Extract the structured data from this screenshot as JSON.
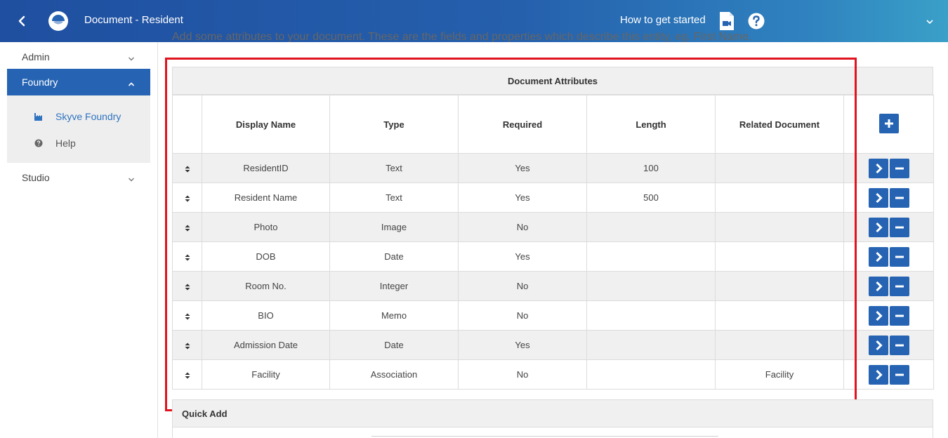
{
  "header": {
    "title": "Document - Resident",
    "how_to_label": "How to get started"
  },
  "sidebar": {
    "admin_label": "Admin",
    "foundry_label": "Foundry",
    "foundry_items": [
      {
        "label": "Skyve Foundry",
        "icon": "factory-icon"
      },
      {
        "label": "Help",
        "icon": "help-circle-icon"
      }
    ],
    "studio_label": "Studio"
  },
  "main": {
    "intro_text": "Add some attributes to your document. These are the fields and properties which describe this entity, eg. First Name.",
    "grid_title": "Document Attributes",
    "columns": [
      "Display Name",
      "Type",
      "Required",
      "Length",
      "Related Document"
    ],
    "rows": [
      {
        "display_name": "ResidentID",
        "type": "Text",
        "required": "Yes",
        "length": "100",
        "related": ""
      },
      {
        "display_name": "Resident Name",
        "type": "Text",
        "required": "Yes",
        "length": "500",
        "related": ""
      },
      {
        "display_name": "Photo",
        "type": "Image",
        "required": "No",
        "length": "",
        "related": ""
      },
      {
        "display_name": "DOB",
        "type": "Date",
        "required": "Yes",
        "length": "",
        "related": ""
      },
      {
        "display_name": "Room No.",
        "type": "Integer",
        "required": "No",
        "length": "",
        "related": ""
      },
      {
        "display_name": "BIO",
        "type": "Memo",
        "required": "No",
        "length": "",
        "related": ""
      },
      {
        "display_name": "Admission Date",
        "type": "Date",
        "required": "Yes",
        "length": "",
        "related": ""
      },
      {
        "display_name": "Facility",
        "type": "Association",
        "required": "No",
        "length": "",
        "related": "Facility"
      }
    ],
    "quick_add_label": "Quick Add"
  },
  "colors": {
    "accent": "#2664b3",
    "highlight": "#e0141e"
  }
}
